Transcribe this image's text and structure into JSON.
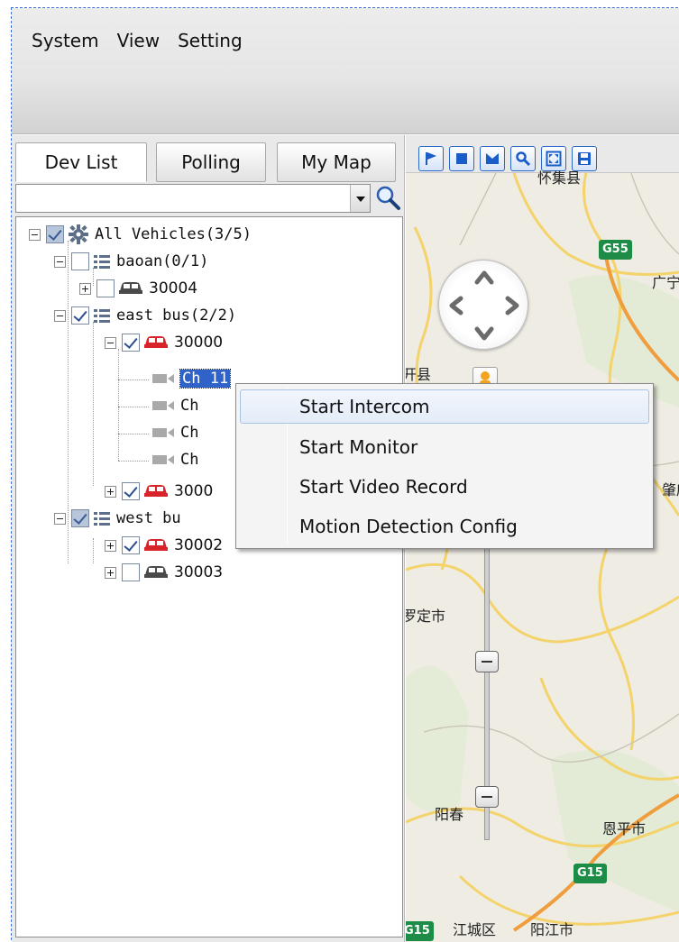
{
  "menubar": {
    "items": [
      "System",
      "View",
      "Setting"
    ]
  },
  "left_panel": {
    "tabs": [
      "Dev List",
      "Polling",
      "My Map"
    ],
    "search": {
      "value": ""
    },
    "tree": {
      "root": "All Vehicles(3/5)",
      "groups": [
        {
          "label": "baoan(0/1)",
          "vehicles": [
            "30004"
          ]
        },
        {
          "label": "east bus(2/2)",
          "vehicles": [
            "30000",
            "3000"
          ],
          "channels": [
            "Ch",
            "Ch",
            "Ch",
            "Ch"
          ]
        },
        {
          "label": "west bu",
          "vehicles": [
            "30002",
            "30003"
          ]
        }
      ],
      "selected_channel": "Ch   11"
    }
  },
  "map": {
    "labels": [
      "怀集县",
      "广宁",
      "开县",
      "肇庆",
      "罗定市",
      "阳春",
      "恩平市",
      "江城区",
      "阳江市"
    ],
    "shields": [
      "G55",
      "G15",
      "G15"
    ]
  },
  "context_menu": {
    "items": [
      "Start Intercom",
      "Start Monitor",
      "Start Video Record",
      "Motion Detection Config"
    ],
    "hovered": "Start Intercom"
  },
  "colors": {
    "selection_blue": "#2f63c9",
    "vehicle_red": "#d8232a",
    "vehicle_gray": "#4a4a4a",
    "highway_green": "#1d8c46"
  }
}
